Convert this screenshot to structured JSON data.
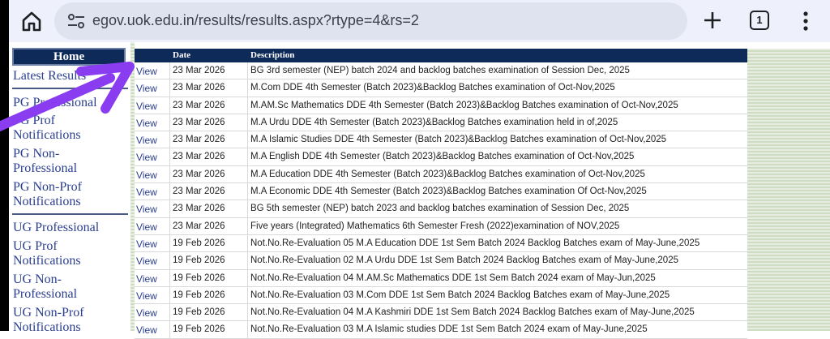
{
  "browser": {
    "url": "egov.uok.edu.in/results/results.aspx?rtype=4&rs=2",
    "tab_count": "1"
  },
  "leftnav": {
    "home_label": "Home",
    "items": [
      "Latest Results",
      "PG Professional",
      "PG Prof",
      "Notifications",
      "PG Non-",
      "Professional",
      "PG Non-Prof",
      "Notifications",
      "UG Professional",
      "UG Prof",
      "Notifications",
      "UG Non-",
      "Professional",
      "UG Non-Prof",
      "Notifications"
    ]
  },
  "table": {
    "headers": {
      "date": "Date",
      "description": "Description"
    },
    "rows": [
      {
        "view": "View",
        "date": "23 Mar 2026",
        "desc": "BG 3rd semester (NEP) batch 2024 and backlog batches examination of Session Dec, 2025"
      },
      {
        "view": "View",
        "date": "23 Mar 2026",
        "desc": "M.Com DDE 4th Semester (Batch 2023)&Backlog Batches examination of Oct-Nov,2025"
      },
      {
        "view": "View",
        "date": "23 Mar 2026",
        "desc": "M.AM.Sc Mathematics DDE 4th Semester (Batch 2023)&Backlog Batches examination of Oct-Nov,2025"
      },
      {
        "view": "View",
        "date": "23 Mar 2026",
        "desc": "M.A Urdu DDE 4th Semester (Batch 2023)&Backlog Batches examination held in of,2025"
      },
      {
        "view": "View",
        "date": "23 Mar 2026",
        "desc": "M.A Islamic Studies DDE 4th Semester (Batch 2023)&Backlog Batches examination of Oct-Nov,2025"
      },
      {
        "view": "View",
        "date": "23 Mar 2026",
        "desc": "M.A English DDE 4th Semester (Batch 2023)&Backlog Batches examination of Oct-Nov,2025"
      },
      {
        "view": "View",
        "date": "23 Mar 2026",
        "desc": "M.A Education DDE 4th Semester (Batch 2023)&Backlog Batches examination of Oct-Nov,2025"
      },
      {
        "view": "View",
        "date": "23 Mar 2026",
        "desc": "M.A Economic DDE 4th Semester (Batch 2023)&Backlog Batches examination Of Oct-Nov,2025"
      },
      {
        "view": "View",
        "date": "23 Mar 2026",
        "desc": "BG 5th semester (NEP) batch 2023 and backlog batches examination of Session Dec, 2025"
      },
      {
        "view": "View",
        "date": "23 Mar 2026",
        "desc": "Five years (Integrated) Mathematics 6th Semester Fresh (2022)examination of NOV,2025"
      },
      {
        "view": "View",
        "date": "19 Feb 2026",
        "desc": "Not.No.Re-Evaluation 05 M.A Education DDE 1st Sem Batch 2024 Backlog Batches exam of May-June,2025"
      },
      {
        "view": "View",
        "date": "19 Feb 2026",
        "desc": "Not.No.Re-Evaluation 02 M.A Urdu DDE 1st Sem Batch 2024 Backlog Batches exam of May-June,2025"
      },
      {
        "view": "View",
        "date": "19 Feb 2026",
        "desc": "Not.No.Re-Evaluation 04 M.AM.Sc Mathematics DDE 1st Sem Batch 2024 exam of May-Jun,2025"
      },
      {
        "view": "View",
        "date": "19 Feb 2026",
        "desc": "Not.No.Re-Evaluation 03 M.Com DDE 1st Sem Batch 2024 Backlog Batches exam of May-June,2025"
      },
      {
        "view": "View",
        "date": "19 Feb 2026",
        "desc": "Not.No.Re-Evaluation 04 M.A Kashmiri DDE 1st Sem Batch 2024 Backlog Batches exam of May-June,2025"
      },
      {
        "view": "View",
        "date": "19 Feb 2026",
        "desc": "Not.No.Re-Evaluation 03 M.A Islamic studies DDE 1st Sem Batch 2024 exam of May-June,2025"
      }
    ]
  },
  "colors": {
    "header_navy": "#0e2a58",
    "link_blue": "#2a3e8e",
    "annotation_purple": "#8a3cf0"
  }
}
